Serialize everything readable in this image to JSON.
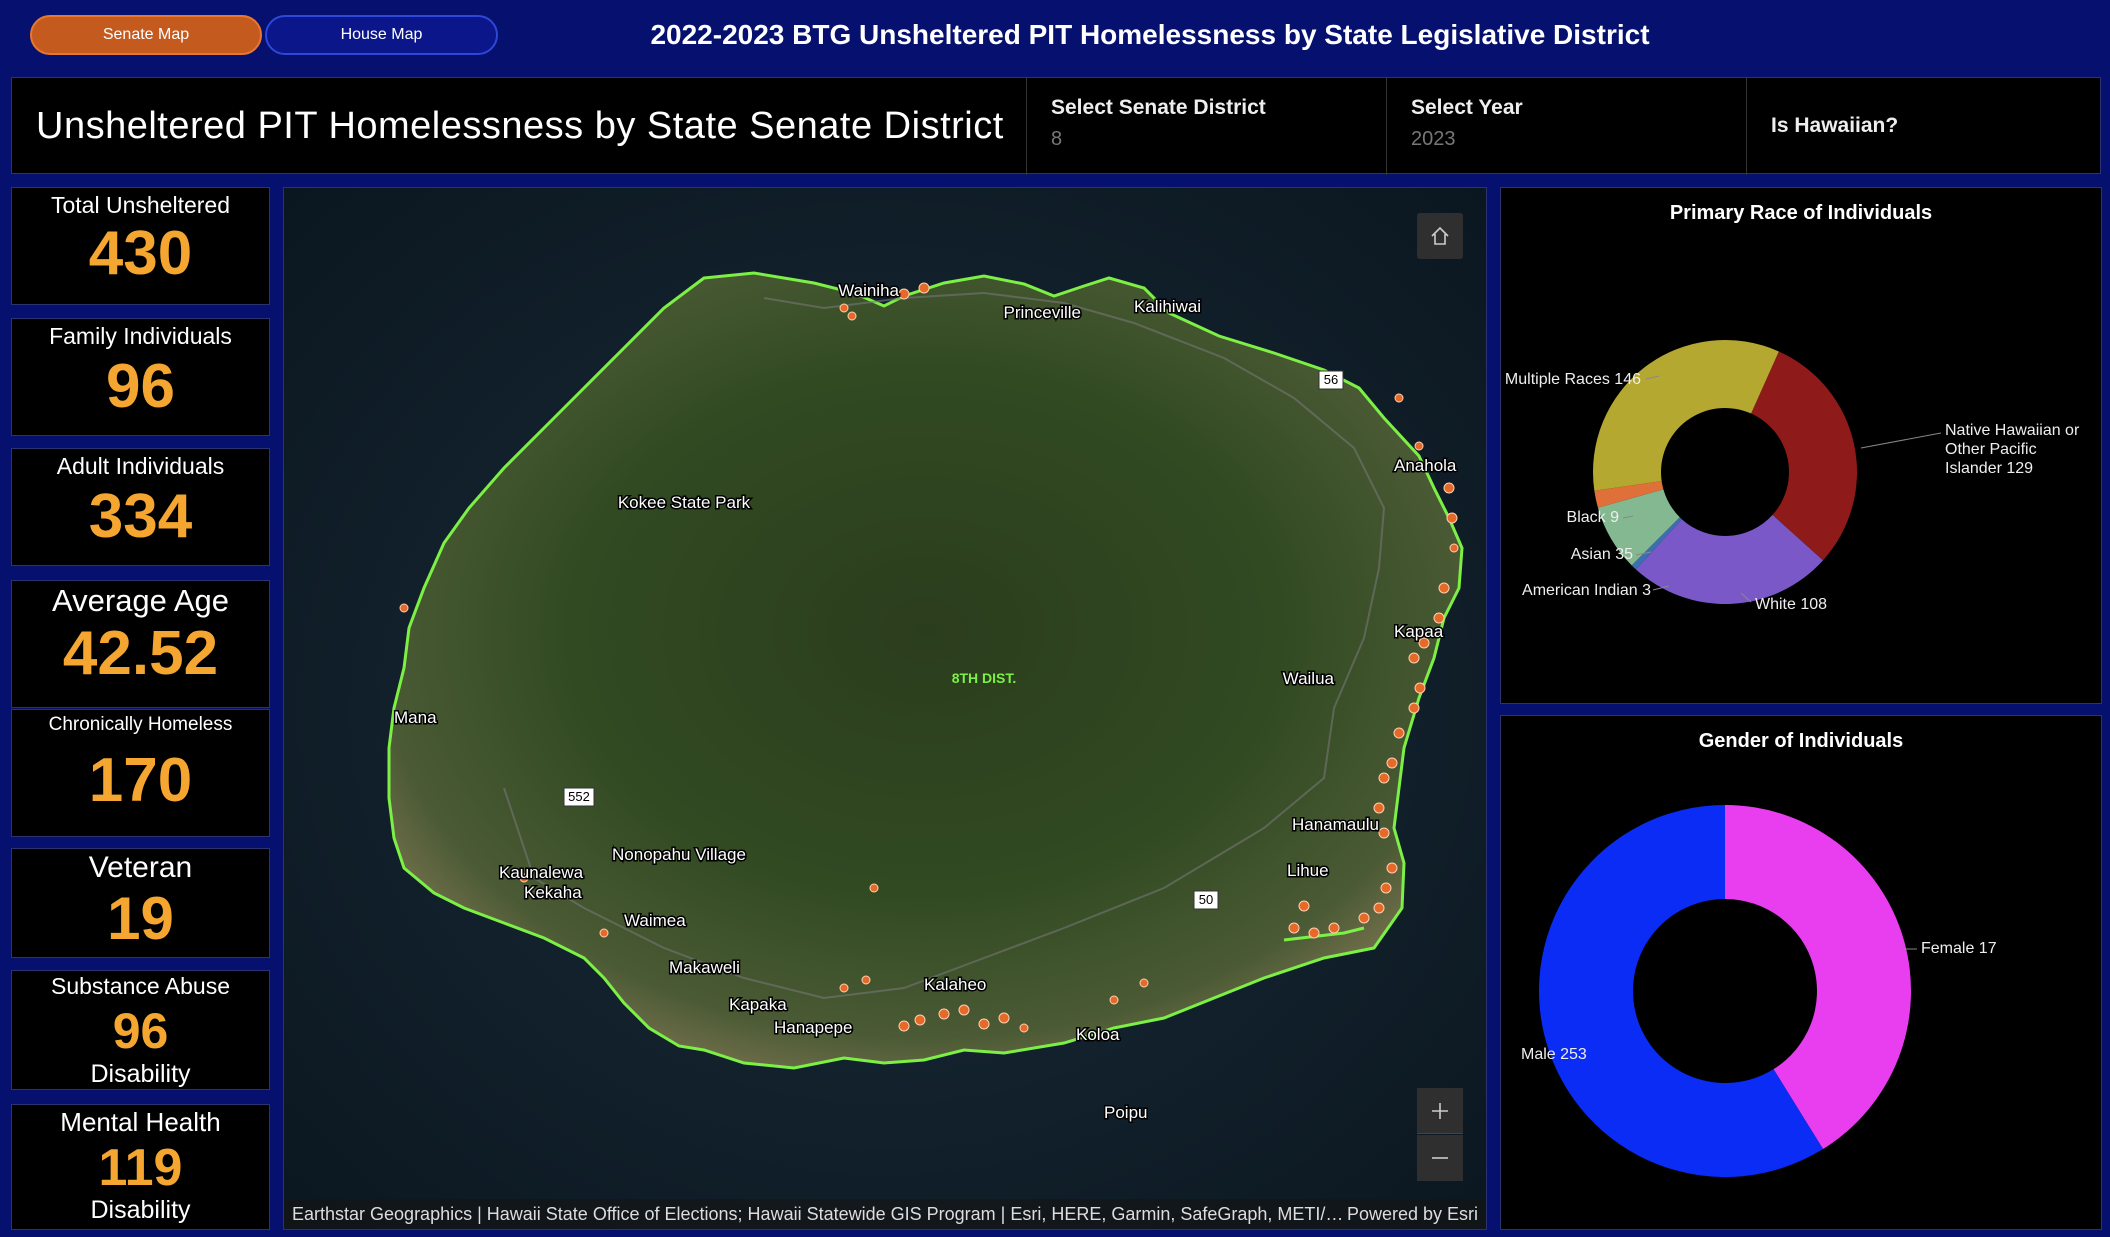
{
  "nav": {
    "senate_label": "Senate Map",
    "house_label": "House Map"
  },
  "app_title": "2022-2023 BTG Unsheltered PIT Homelessness by State Legislative District",
  "header": {
    "title": "Unsheltered PIT Homelessness by State Senate District",
    "senate_label": "Select Senate District",
    "senate_value": "8",
    "year_label": "Select Year",
    "year_value": "2023",
    "hawaiian_label": "Is Hawaiian?"
  },
  "stats": [
    {
      "label": "Total Unsheltered",
      "value": "430",
      "sub": ""
    },
    {
      "label": "Family Individuals",
      "value": "96",
      "sub": ""
    },
    {
      "label": "Adult Individuals",
      "value": "334",
      "sub": ""
    },
    {
      "label": "Average Age",
      "value": "42.52",
      "sub": ""
    },
    {
      "label": "Chronically Homeless",
      "value": "170",
      "sub": ""
    },
    {
      "label": "Veteran",
      "value": "19",
      "sub": ""
    },
    {
      "label": "Substance Abuse",
      "value": "96",
      "sub": "Disability"
    },
    {
      "label": "Mental Health",
      "value": "119",
      "sub": "Disability"
    }
  ],
  "map": {
    "district_label": "8TH DIST.",
    "places": [
      "Wainiha",
      "Princeville",
      "Kalihiwai",
      "Anahola",
      "Kokee State Park",
      "Kapaa",
      "Wailua",
      "Mana",
      "Hanamaulu",
      "Lihue",
      "Nonopahu Village",
      "Kaunalewa",
      "Kekaha",
      "Waimea",
      "Makaweli",
      "Kalaheo",
      "Kapaka",
      "Hanapepe",
      "Koloa",
      "Poipu"
    ],
    "route_shields": [
      "56",
      "552",
      "50"
    ],
    "attribution": "Earthstar Geographics | Hawaii State Office of Elections; Hawaii Statewide GIS Program | Esri, HERE, Garmin, SafeGraph, METI/…",
    "powered_by": "Powered by Esri",
    "home_icon": "home-icon",
    "zoom_in_icon": "plus-icon",
    "zoom_out_icon": "minus-icon"
  },
  "chart_data": [
    {
      "type": "pie",
      "donut": true,
      "title": "Primary Race of Individuals",
      "series": [
        {
          "name": "Native Hawaiian or Other Pacific Islander",
          "value": 129,
          "color": "#8e1a1a"
        },
        {
          "name": "White",
          "value": 108,
          "color": "#7a58c8"
        },
        {
          "name": "American Indian",
          "value": 3,
          "color": "#3b6fb3"
        },
        {
          "name": "Asian",
          "value": 35,
          "color": "#84b890"
        },
        {
          "name": "Black",
          "value": 9,
          "color": "#e0703a"
        },
        {
          "name": "Multiple Races",
          "value": 146,
          "color": "#b5a830"
        }
      ],
      "labels": [
        "Native Hawaiian or",
        "Other Pacific",
        "Islander 129",
        "White 108",
        "American Indian 3",
        "Asian 35",
        "Black 9",
        "Multiple Races 146"
      ]
    },
    {
      "type": "pie",
      "donut": true,
      "title": "Gender of Individuals",
      "series": [
        {
          "name": "Female",
          "value": 177,
          "color": "#e83ef0"
        },
        {
          "name": "Male",
          "value": 253,
          "color": "#0a2cf5"
        }
      ],
      "labels": [
        "Female 17",
        "Male 253"
      ]
    }
  ]
}
